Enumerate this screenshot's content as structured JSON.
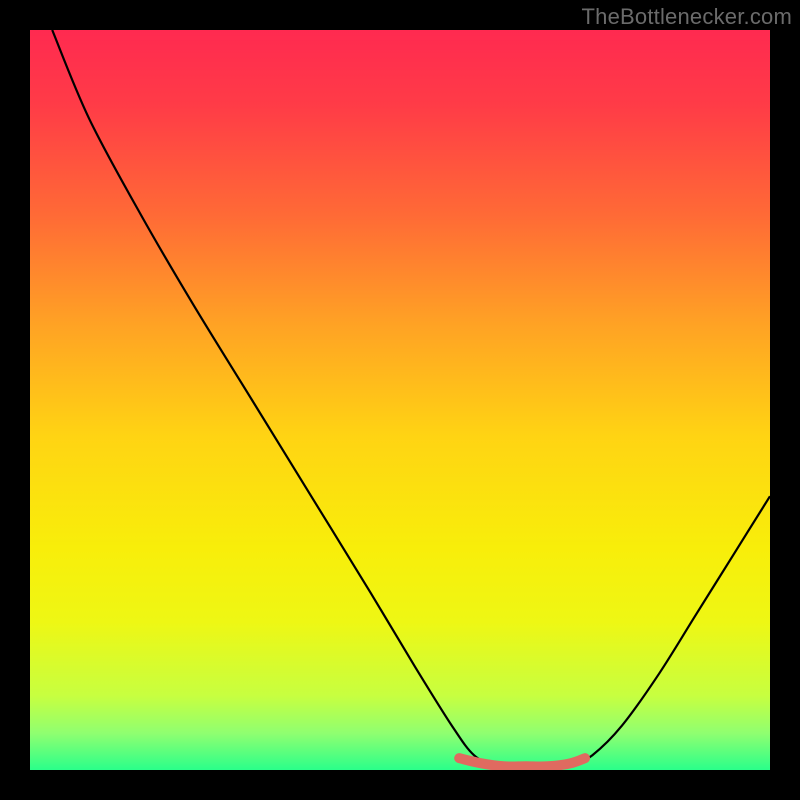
{
  "watermark": "TheBottlenecker.com",
  "chart_data": {
    "type": "line",
    "title": "",
    "xlabel": "",
    "ylabel": "",
    "xlim": [
      0,
      100
    ],
    "ylim": [
      0,
      100
    ],
    "background_gradient": {
      "stops": [
        {
          "offset": 0.0,
          "color": "#ff2a50"
        },
        {
          "offset": 0.1,
          "color": "#ff3b47"
        },
        {
          "offset": 0.25,
          "color": "#ff6a36"
        },
        {
          "offset": 0.4,
          "color": "#ffa324"
        },
        {
          "offset": 0.55,
          "color": "#ffd413"
        },
        {
          "offset": 0.7,
          "color": "#f8ee0a"
        },
        {
          "offset": 0.8,
          "color": "#eef714"
        },
        {
          "offset": 0.9,
          "color": "#c7ff40"
        },
        {
          "offset": 0.95,
          "color": "#90ff70"
        },
        {
          "offset": 1.0,
          "color": "#2aff8a"
        }
      ]
    },
    "series": [
      {
        "name": "bottleneck-curve",
        "color": "#000000",
        "width": 2.2,
        "points": [
          {
            "x": 3.0,
            "y": 100.0
          },
          {
            "x": 8.0,
            "y": 88.0
          },
          {
            "x": 15.0,
            "y": 75.0
          },
          {
            "x": 22.0,
            "y": 63.0
          },
          {
            "x": 30.0,
            "y": 50.0
          },
          {
            "x": 38.0,
            "y": 37.0
          },
          {
            "x": 46.0,
            "y": 24.0
          },
          {
            "x": 52.0,
            "y": 14.0
          },
          {
            "x": 57.0,
            "y": 6.0
          },
          {
            "x": 60.0,
            "y": 2.0
          },
          {
            "x": 63.0,
            "y": 0.5
          },
          {
            "x": 66.0,
            "y": 0.0
          },
          {
            "x": 70.0,
            "y": 0.0
          },
          {
            "x": 73.0,
            "y": 0.5
          },
          {
            "x": 76.0,
            "y": 2.0
          },
          {
            "x": 80.0,
            "y": 6.0
          },
          {
            "x": 85.0,
            "y": 13.0
          },
          {
            "x": 90.0,
            "y": 21.0
          },
          {
            "x": 95.0,
            "y": 29.0
          },
          {
            "x": 100.0,
            "y": 37.0
          }
        ]
      },
      {
        "name": "optimal-band",
        "color": "#e06a60",
        "width": 10,
        "points": [
          {
            "x": 58.0,
            "y": 1.6
          },
          {
            "x": 61.0,
            "y": 0.9
          },
          {
            "x": 64.0,
            "y": 0.5
          },
          {
            "x": 67.0,
            "y": 0.5
          },
          {
            "x": 70.0,
            "y": 0.5
          },
          {
            "x": 73.0,
            "y": 0.9
          },
          {
            "x": 75.0,
            "y": 1.6
          }
        ]
      }
    ]
  }
}
